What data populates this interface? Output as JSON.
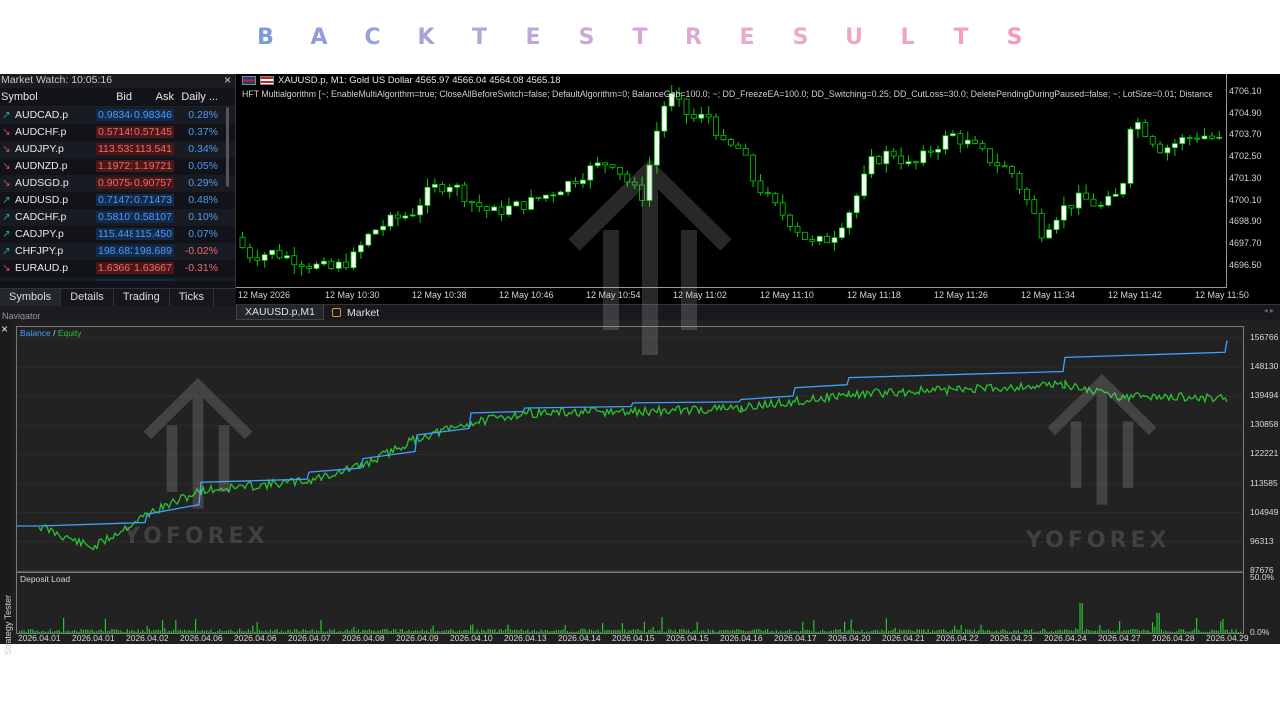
{
  "banner": {
    "letters": [
      "B",
      "A",
      "C",
      "K",
      "T",
      "E",
      "S",
      "T",
      "R",
      "E",
      "S",
      "U",
      "L",
      "T",
      "S"
    ],
    "colors": [
      "#7d9bd8",
      "#8d9ed8",
      "#9aa1d8",
      "#a6a3d8",
      "#b2a6d8",
      "#bea8d8",
      "#c9a9d6",
      "#d3a9d2",
      "#dcaad0",
      "#e4abcc",
      "#eaaac8",
      "#eea8c4",
      "#f0a4c0",
      "#f2a0bc",
      "#f29ab6"
    ]
  },
  "market_watch": {
    "title": "Market Watch: 10:05:16",
    "close": "×",
    "headers": {
      "symbol": "Symbol",
      "bid": "Bid",
      "ask": "Ask",
      "daily": "Daily ..."
    },
    "rows": [
      {
        "symbol": "AUDCAD.p",
        "bid": "0.98344",
        "ask": "0.98346",
        "daily": "0.28%",
        "dir": "up"
      },
      {
        "symbol": "AUDCHF.p",
        "bid": "0.57145",
        "ask": "0.57145",
        "daily": "0.37%",
        "dir": "down"
      },
      {
        "symbol": "AUDJPY.p",
        "bid": "113.533",
        "ask": "113.541",
        "daily": "0.34%",
        "dir": "down"
      },
      {
        "symbol": "AUDNZD.p",
        "bid": "1.19721",
        "ask": "1.19721",
        "daily": "0.05%",
        "dir": "down"
      },
      {
        "symbol": "AUDSGD.p",
        "bid": "0.90754",
        "ask": "0.90757",
        "daily": "0.29%",
        "dir": "down"
      },
      {
        "symbol": "AUDUSD.p",
        "bid": "0.71472",
        "ask": "0.71473",
        "daily": "0.48%",
        "dir": "up"
      },
      {
        "symbol": "CADCHF.p",
        "bid": "0.58107",
        "ask": "0.58107",
        "daily": "0.10%",
        "dir": "up"
      },
      {
        "symbol": "CADJPY.p",
        "bid": "115.448",
        "ask": "115.450",
        "daily": "0.07%",
        "dir": "up"
      },
      {
        "symbol": "CHFJPY.p",
        "bid": "198.683",
        "ask": "198.689",
        "daily": "-0.02%",
        "dir": "up"
      },
      {
        "symbol": "EURAUD.p",
        "bid": "1.63667",
        "ask": "1.63667",
        "daily": "-0.31%",
        "dir": "down"
      },
      {
        "symbol": "EURUSD",
        "bid": "1.16975",
        "ask": "1.16975",
        "daily": "0.16%",
        "dir": "up"
      }
    ],
    "tabs": [
      "Symbols",
      "Details",
      "Trading",
      "Ticks"
    ],
    "navigator": "Navigator"
  },
  "price_chart": {
    "symbol_line": "XAUUSD.p, M1:  Gold US Dollar  4565.97 4566.04 4564.08 4565.18",
    "params_line": "HFT Multialgorithm [~; EnableMultiAlgorithm=true; CloseAllBeforeSwitch=false; DefaultAlgorithm=0; BalanceGab=100.0; ~; DD_FreezeEA=100.0; DD_Switching=0.25; DD_CutLoss=30.0; DeletePendingDuringPaused=false; ~; LotSize=0.01; DistancePoints=100; UseHi",
    "price_ticks": [
      "4706.10",
      "4704.90",
      "4703.70",
      "4702.50",
      "4701.30",
      "4700.10",
      "4698.90",
      "4697.70",
      "4696.50"
    ],
    "time_ticks": [
      "12 May 2026",
      "12 May 10:30",
      "12 May 10:38",
      "12 May 10:46",
      "12 May 10:54",
      "12 May 11:02",
      "12 May 11:10",
      "12 May 11:18",
      "12 May 11:26",
      "12 May 11:34",
      "12 May 11:42",
      "12 May 11:50"
    ],
    "bull_color": "#ffffff",
    "bear_color": "#000000",
    "wick_color": "#00d000"
  },
  "chart_tabs": [
    "XAUUSD.p,M1",
    "Market"
  ],
  "tester": {
    "side_label": "Strategy Tester",
    "close": "×",
    "legend": {
      "balance": "Balance",
      "sep": " / ",
      "equity": "Equity"
    },
    "balance_ticks": [
      "156766",
      "148130",
      "139494",
      "130858",
      "122221",
      "113585",
      "104949",
      "96313",
      "87676"
    ],
    "deposit_label": "Deposit Load",
    "deposit_ticks": [
      "50.0%",
      "0.0%"
    ],
    "date_ticks": [
      "2026.04.01",
      "2026.04.01",
      "2026.04.02",
      "2026.04.06",
      "2026.04.06",
      "2026.04.07",
      "2026.04.08",
      "2026.04.09",
      "2026.04.10",
      "2026.04.13",
      "2026.04.14",
      "2026.04.15",
      "2026.04.15",
      "2026.04.16",
      "2026.04.17",
      "2026.04.20",
      "2026.04.21",
      "2026.04.22",
      "2026.04.23",
      "2026.04.24",
      "2026.04.27",
      "2026.04.28",
      "2026.04.29"
    ],
    "balance_color": "#3ea0ff",
    "equity_color": "#2bc230"
  },
  "watermark": {
    "text": "YOFOREX"
  },
  "chart_data": [
    {
      "type": "line",
      "title": "",
      "series": [
        {
          "name": "Balance",
          "x": [
            "2026.04.01",
            "2026.04.02",
            "2026.04.06",
            "2026.04.07",
            "2026.04.08",
            "2026.04.09",
            "2026.04.10",
            "2026.04.13",
            "2026.04.15",
            "2026.04.16",
            "2026.04.17",
            "2026.04.20",
            "2026.04.24",
            "2026.04.29"
          ],
          "values": [
            101000,
            104500,
            114000,
            117000,
            121000,
            128000,
            134500,
            136000,
            137500,
            138500,
            142000,
            145000,
            151000,
            156000
          ]
        },
        {
          "name": "Equity",
          "x": [
            "2026.04.01",
            "2026.04.01",
            "2026.04.02",
            "2026.04.06",
            "2026.04.07",
            "2026.04.08",
            "2026.04.09",
            "2026.04.10",
            "2026.04.13",
            "2026.04.15",
            "2026.04.16",
            "2026.04.17",
            "2026.04.20",
            "2026.04.22",
            "2026.04.24",
            "2026.04.27",
            "2026.04.29"
          ],
          "values": [
            101000,
            94500,
            104500,
            111500,
            114500,
            119000,
            127000,
            131500,
            134500,
            134800,
            136000,
            138000,
            140000,
            141500,
            143000,
            139500,
            139000
          ]
        }
      ],
      "ylim": [
        87676,
        160000
      ],
      "yticks": [
        87676,
        96313,
        104949,
        113585,
        122221,
        130858,
        139494,
        148130,
        156766
      ]
    },
    {
      "type": "bar",
      "title": "Deposit Load",
      "ylim": [
        0,
        50
      ],
      "yunit": "%"
    }
  ]
}
